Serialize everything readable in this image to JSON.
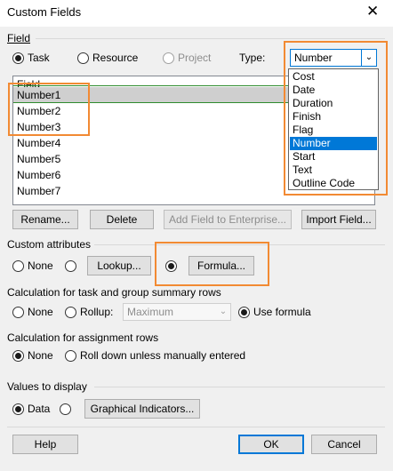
{
  "window": {
    "title": "Custom Fields",
    "close_glyph": "✕"
  },
  "field": {
    "group_label": "Field",
    "radios": [
      {
        "label": "Task",
        "checked": true,
        "enabled": true
      },
      {
        "label": "Resource",
        "checked": false,
        "enabled": true
      },
      {
        "label": "Project",
        "checked": false,
        "enabled": false
      }
    ],
    "type_label": "Type:",
    "type_value": "Number",
    "type_options": [
      "Cost",
      "Date",
      "Duration",
      "Finish",
      "Flag",
      "Number",
      "Start",
      "Text",
      "Outline Code"
    ],
    "type_selected": "Number",
    "list_header": "Field",
    "list_items": [
      "Number1",
      "Number2",
      "Number3",
      "Number4",
      "Number5",
      "Number6",
      "Number7"
    ],
    "list_selected": "Number1",
    "buttons": {
      "rename": "Rename...",
      "delete": "Delete",
      "add_to_enterprise": "Add Field to Enterprise...",
      "import": "Import Field..."
    }
  },
  "custom_attributes": {
    "label": "Custom attributes",
    "none_label": "None",
    "lookup_button": "Lookup...",
    "formula_button": "Formula...",
    "selected": "formula"
  },
  "summary_rows": {
    "label": "Calculation for task and group summary rows",
    "none_label": "None",
    "rollup_label": "Rollup:",
    "rollup_value": "Maximum",
    "use_formula_label": "Use formula",
    "selected": "use_formula"
  },
  "assignment_rows": {
    "label": "Calculation for assignment rows",
    "none_label": "None",
    "rolldown_label": "Roll down unless manually entered",
    "selected": "none"
  },
  "values_to_display": {
    "label": "Values to display",
    "data_label": "Data",
    "graphical_button": "Graphical Indicators...",
    "selected": "data"
  },
  "footer": {
    "help": "Help",
    "ok": "OK",
    "cancel": "Cancel"
  },
  "colors": {
    "highlight": "#f28a33",
    "selection": "#0078d7"
  }
}
